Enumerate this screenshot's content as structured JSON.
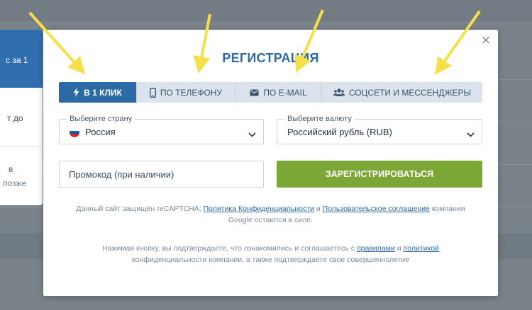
{
  "background": {
    "side_card": {
      "item1": "с за 1",
      "item2": "т до",
      "item3": "в",
      "item4": "позже"
    }
  },
  "modal": {
    "title": "РЕГИСТРАЦИЯ",
    "close_label": "×",
    "tabs": [
      {
        "label": "В 1 КЛИК",
        "icon": "lightning-icon",
        "active": true
      },
      {
        "label": "ПО ТЕЛЕФОНУ",
        "icon": "phone-icon",
        "active": false
      },
      {
        "label": "ПО E-MAIL",
        "icon": "envelope-icon",
        "active": false
      },
      {
        "label": "СОЦСЕТИ И МЕССЕНДЖЕРЫ",
        "icon": "users-icon",
        "active": false
      }
    ],
    "country": {
      "label": "Выберите страну",
      "value": "Россия"
    },
    "currency": {
      "label": "Выберите валюту",
      "value": "Российский рубль (RUB)"
    },
    "promo": {
      "placeholder": "Промокод (при наличии)"
    },
    "register_button": "ЗАРЕГИСТРИРОВАТЬСЯ",
    "recaptcha_note": {
      "prefix": "Данный сайт защищён reCAPTCHA;",
      "privacy_link": "Политика Конфиденциальности",
      "and": "и",
      "terms_link": "Пользовательское соглашение",
      "suffix_line1": "компании",
      "line2": "Google остаются в силе."
    },
    "consent_note": {
      "prefix": "Нажимая кнопку, вы подтверждаете, что ознакомились и соглашаетесь с",
      "rules_link": "правилами",
      "and": "и",
      "policy_link": "политикой",
      "line2": "конфиденциальности компании, а также подтверждаете свое совершеннолетие"
    }
  },
  "colors": {
    "accent": "#2c6aa5",
    "register": "#7aa735",
    "overlay": "#7b838a",
    "arrows": "#f5e04a"
  }
}
